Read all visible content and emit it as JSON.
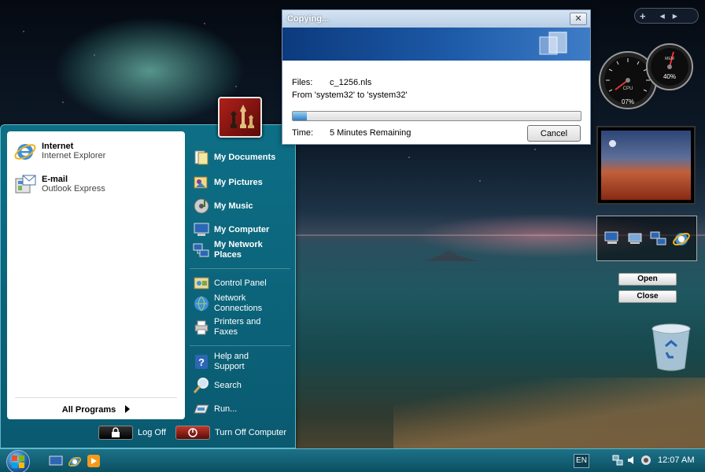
{
  "start_menu": {
    "pinned": [
      {
        "title": "Internet",
        "subtitle": "Internet Explorer",
        "icon": "internet-explorer-icon"
      },
      {
        "title": "E-mail",
        "subtitle": "Outlook Express",
        "icon": "outlook-express-icon"
      }
    ],
    "all_programs": "All Programs",
    "right_items": {
      "my_documents": "My Documents",
      "my_pictures": "My Pictures",
      "my_music": "My Music",
      "my_computer": "My Computer",
      "my_network": "My Network Places",
      "control_panel": "Control Panel",
      "network_connections": "Network Connections",
      "printers": "Printers and Faxes",
      "help": "Help and Support",
      "search": "Search",
      "run": "Run..."
    },
    "log_off": "Log Off",
    "turn_off": "Turn Off Computer"
  },
  "copy_dialog": {
    "title": "Copying...",
    "close": "✕",
    "files_label": "Files:",
    "files_value": "c_1256.nls",
    "from_to": "From 'system32' to 'system32'",
    "time_label": "Time:",
    "time_value": "5 Minutes Remaining",
    "progress": 0.05,
    "cancel": "Cancel"
  },
  "sidebar": {
    "top_bar": {
      "add": "+",
      "prev": "◀",
      "next": "▶"
    },
    "cpu_label": "CPU",
    "cpu_percent": "07%",
    "mem_label": "MEM",
    "mem_percent": "40%",
    "open": "Open",
    "close": "Close"
  },
  "taskbar": {
    "language": "EN",
    "clock": "12:07 AM"
  }
}
